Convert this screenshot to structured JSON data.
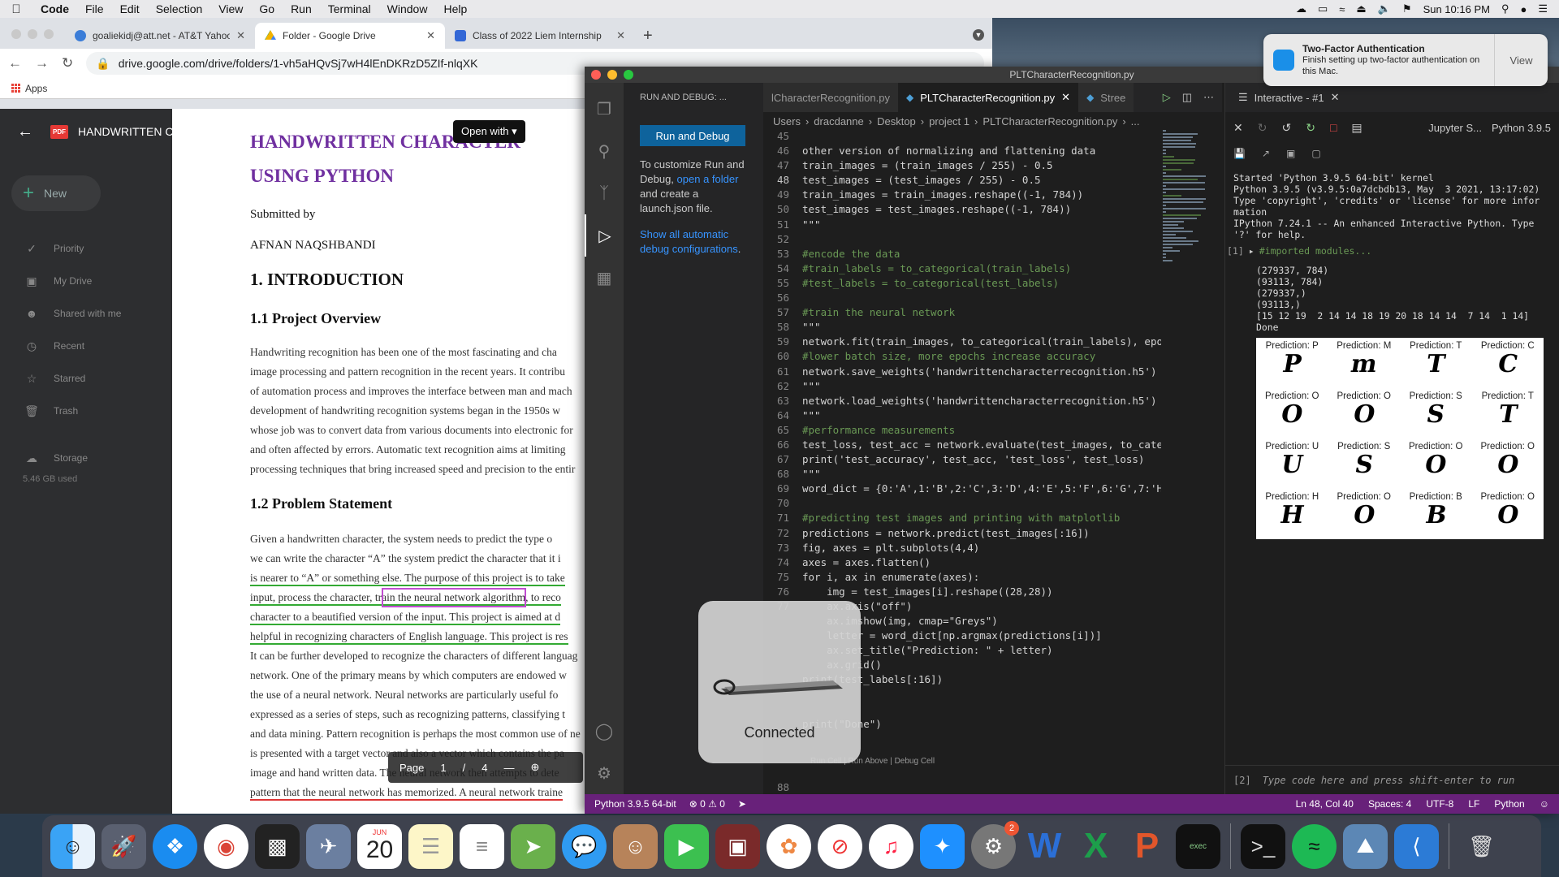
{
  "menubar": {
    "app": "Code",
    "menus": [
      "File",
      "Edit",
      "Selection",
      "View",
      "Go",
      "Run",
      "Terminal",
      "Window",
      "Help"
    ],
    "clock": "Sun 10:16 PM"
  },
  "chrome": {
    "tabs": [
      {
        "title": "goaliekidj@att.net - AT&T Yahoo",
        "color": "#3b7dd8"
      },
      {
        "title": "Folder - Google Drive",
        "color": "#f2b400"
      },
      {
        "title": "Class of 2022 Liem Internship",
        "color": "#3367d6"
      }
    ],
    "url": "drive.google.com/drive/folders/1-vh5aHQvSj7wH4lEnDKRzD5ZIf-nlqXK",
    "bookmark_apps": "Apps"
  },
  "drive": {
    "new_label": "New",
    "nav": [
      {
        "label": "Priority",
        "icon": "check-circle-icon"
      },
      {
        "label": "My Drive",
        "icon": "drive-icon"
      },
      {
        "label": "Shared with me",
        "icon": "people-icon"
      },
      {
        "label": "Recent",
        "icon": "clock-icon"
      },
      {
        "label": "Starred",
        "icon": "star-icon"
      },
      {
        "label": "Trash",
        "icon": "trash-icon"
      }
    ],
    "storage_label": "Storage",
    "storage_used": "5.46 GB used"
  },
  "pdf": {
    "filename": "HANDWRITTEN CHARACTER RECOGNITION USING PYTHON.pdf",
    "open_with": "Open with",
    "title_line1": "HANDWRITTEN        CHARACTER",
    "title_line2": "USING PYTHON",
    "submitted_by": "Submitted by",
    "author": "AFNAN NAQSHBANDI",
    "h_intro": "1. INTRODUCTION",
    "h_overview": "1.1 Project Overview",
    "overview_lines": [
      "Handwriting recognition has been one of the most fascinating and cha",
      "image processing and pattern recognition in the recent years. It contribu",
      "of automation process and improves the interface between man and mach",
      "development of handwriting recognition systems began in the 1950s w",
      "whose job was to convert data from various documents into electronic for",
      "and often affected by errors. Automatic text recognition aims at limiting",
      "processing techniques that bring increased speed and precision to the entir"
    ],
    "h_problem": "1.2 Problem Statement",
    "problem_lines": [
      "Given a handwritten character, the system needs to predict the type o",
      "we can write the character “A” the system predict the character that it i",
      "is nearer to “A” or something else. The purpose of this project is to take",
      "input, process the character, train the neural network algorithm, to reco",
      "character to a beautified version of the input. This project is aimed at d",
      "helpful in recognizing characters of English language. This project is res",
      "It can be further developed to recognize the characters of different languag",
      "network. One of the primary means by which computers are endowed w",
      "the use of a neural network. Neural networks are particularly useful fo",
      "expressed as a series of steps, such as recognizing patterns, classifying t",
      "and data mining. Pattern recognition is perhaps the most common use of ne",
      "is presented with a target vector and also a vector which contains the pa",
      "image and hand written data. The neural network then attempts to dete",
      "pattern that the neural network has memorized. A neural network traine"
    ],
    "page_label": "Page",
    "page_current": "1",
    "page_sep": "/",
    "page_total": "4"
  },
  "notification": {
    "title": "Two-Factor Authentication",
    "body": "Finish setting up two-factor authentication on this Mac.",
    "action": "View"
  },
  "vscode": {
    "window_title": "PLTCharacterRecognition.py",
    "sidebar_title": "RUN AND DEBUG: ...",
    "run_debug_button": "Run and Debug",
    "help_pre": "To customize Run and Debug, ",
    "help_link": "open a folder",
    "help_post": " and create a launch.json file.",
    "show_all_link": "Show all automatic debug configurations",
    "show_all_tail": ".",
    "tabs": [
      {
        "title": "lCharacterRecognition.py",
        "active": false
      },
      {
        "title": "PLTCharacterRecognition.py",
        "active": true
      },
      {
        "title": "Stree",
        "active": false
      }
    ],
    "breadcrumbs": [
      "Users",
      "dracdanne",
      "Desktop",
      "project 1",
      "PLTCharacterRecognition.py",
      "..."
    ],
    "current_line": 48,
    "code_lines": [
      {
        "n": "45",
        "text": ""
      },
      {
        "n": "46",
        "text": "other version of normalizing and flattening data"
      },
      {
        "n": "47",
        "text": "train_images = (train_images / 255) - 0.5"
      },
      {
        "n": "48",
        "text": "test_images = (test_images / 255) - 0.5"
      },
      {
        "n": "49",
        "text": "train_images = train_images.reshape((-1, 784))"
      },
      {
        "n": "50",
        "text": "test_images = test_images.reshape((-1, 784))"
      },
      {
        "n": "51",
        "text": "\"\"\""
      },
      {
        "n": "52",
        "text": ""
      },
      {
        "n": "53",
        "text": "#encode the data"
      },
      {
        "n": "54",
        "text": "#train_labels = to_categorical(train_labels)"
      },
      {
        "n": "55",
        "text": "#test_labels = to_categorical(test_labels)"
      },
      {
        "n": "56",
        "text": ""
      },
      {
        "n": "57",
        "text": "#train the neural network"
      },
      {
        "n": "58",
        "text": "\"\"\""
      },
      {
        "n": "59",
        "text": "network.fit(train_images, to_categorical(train_labels), epo"
      },
      {
        "n": "60",
        "text": "#lower batch size, more epochs increase accuracy"
      },
      {
        "n": "61",
        "text": "network.save_weights('handwrittencharacterrecognition.h5')"
      },
      {
        "n": "62",
        "text": "\"\"\""
      },
      {
        "n": "63",
        "text": "network.load_weights('handwrittencharacterrecognition.h5')"
      },
      {
        "n": "64",
        "text": "\"\"\""
      },
      {
        "n": "65",
        "text": "#performance measurements"
      },
      {
        "n": "66",
        "text": "test_loss, test_acc = network.evaluate(test_images, to_cate"
      },
      {
        "n": "67",
        "text": "print('test_accuracy', test_acc, 'test_loss', test_loss)"
      },
      {
        "n": "68",
        "text": "\"\"\""
      },
      {
        "n": "69",
        "text": "word_dict = {0:'A',1:'B',2:'C',3:'D',4:'E',5:'F',6:'G',7:'H"
      },
      {
        "n": "70",
        "text": ""
      },
      {
        "n": "71",
        "text": "#predicting test images and printing with matplotlib"
      },
      {
        "n": "72",
        "text": "predictions = network.predict(test_images[:16])"
      },
      {
        "n": "73",
        "text": "fig, axes = plt.subplots(4,4)"
      },
      {
        "n": "74",
        "text": "axes = axes.flatten()"
      },
      {
        "n": "75",
        "text": "for i, ax in enumerate(axes):"
      },
      {
        "n": "76",
        "text": "    img = test_images[i].reshape((28,28))"
      },
      {
        "n": "77",
        "text": "    ax.axis(\"off\")"
      },
      {
        "n": "",
        "text": "    ax.imshow(img, cmap=\"Greys\")"
      },
      {
        "n": "",
        "text": "    letter = word_dict[np.argmax(predictions[i])]"
      },
      {
        "n": "",
        "text": "    ax.set_title(\"Prediction: \" + letter)"
      },
      {
        "n": "",
        "text": "    ax.grid()"
      },
      {
        "n": "",
        "text": "print(test_labels[:16])"
      },
      {
        "n": "",
        "text": ""
      },
      {
        "n": "",
        "text": ""
      },
      {
        "n": "",
        "text": "print(\"Done\")"
      }
    ],
    "codelens": "Run Cell | Run Above | Debug Cell",
    "last_line_number": "88",
    "interactive_tab": "Interactive - #1",
    "kernel_name": "Jupyter S...",
    "kernel_python": "Python 3.9.5",
    "kernel_banner": "Started 'Python 3.9.5 64-bit' kernel\nPython 3.9.5 (v3.9.5:0a7dcbdb13, May  3 2021, 13:17:02)\nType 'copyright', 'credits' or 'license' for more infor\nmation\nIPython 7.24.1 -- An enhanced Interactive Python. Type\n'?' for help.",
    "cell_number": "[1]",
    "cell_comment": "#imported modules...",
    "cell_output": "(279337, 784)\n(93113, 784)\n(279337,)\n(93113,)\n[15 12 19  2 14 14 18 19 20 18 14 14  7 14  1 14]\nDone",
    "predictions": [
      {
        "title": "Prediction: P",
        "glyph": "P"
      },
      {
        "title": "Prediction: M",
        "glyph": "m"
      },
      {
        "title": "Prediction: T",
        "glyph": "T"
      },
      {
        "title": "Prediction: C",
        "glyph": "C"
      },
      {
        "title": "Prediction: O",
        "glyph": "O"
      },
      {
        "title": "Prediction: O",
        "glyph": "O"
      },
      {
        "title": "Prediction: S",
        "glyph": "S"
      },
      {
        "title": "Prediction: T",
        "glyph": "T"
      },
      {
        "title": "Prediction: U",
        "glyph": "U"
      },
      {
        "title": "Prediction: S",
        "glyph": "S"
      },
      {
        "title": "Prediction: O",
        "glyph": "O"
      },
      {
        "title": "Prediction: O",
        "glyph": "O"
      },
      {
        "title": "Prediction: H",
        "glyph": "H"
      },
      {
        "title": "Prediction: O",
        "glyph": "O"
      },
      {
        "title": "Prediction: B",
        "glyph": "B"
      },
      {
        "title": "Prediction: O",
        "glyph": "O"
      }
    ],
    "input_number": "[2]",
    "input_placeholder": "Type code here and press shift-enter to run",
    "status": {
      "interpreter": "Python 3.9.5 64-bit",
      "problems": "⊗ 0 ⚠ 0",
      "position": "Ln 48, Col 40",
      "spaces": "Spaces: 4",
      "encoding": "UTF-8",
      "eol": "LF",
      "language": "Python"
    }
  },
  "hud": {
    "label": "Connected"
  },
  "dock": {
    "calendar_month": "JUN",
    "calendar_day": "20",
    "settings_badge": "2"
  }
}
